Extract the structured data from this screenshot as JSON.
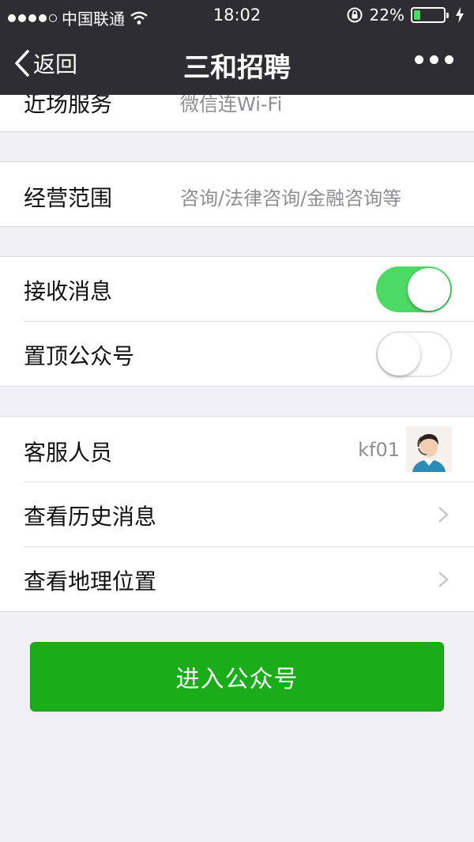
{
  "status_bar": {
    "carrier": "中国联通",
    "time": "18:02",
    "battery": "22%",
    "battery_level": 0.22
  },
  "nav": {
    "back_label": "返回",
    "title": "三和招聘"
  },
  "rows": {
    "service": {
      "label": "近场服务",
      "value": "微信连Wi-Fi"
    },
    "scope": {
      "label": "经营范围",
      "value": "咨询/法律咨询/金融咨询等"
    },
    "receive": {
      "label": "接收消息",
      "on": true
    },
    "pin": {
      "label": "置顶公众号",
      "on": false
    },
    "agent": {
      "label": "客服人员",
      "value": "kf01"
    },
    "history": {
      "label": "查看历史消息"
    },
    "location": {
      "label": "查看地理位置"
    }
  },
  "enter_button": "进入公众号",
  "colors": {
    "nav_bg": "#2e2e32",
    "toggle_on": "#4cd964",
    "primary_button": "#1aad19",
    "page_bg": "#efeff4"
  }
}
